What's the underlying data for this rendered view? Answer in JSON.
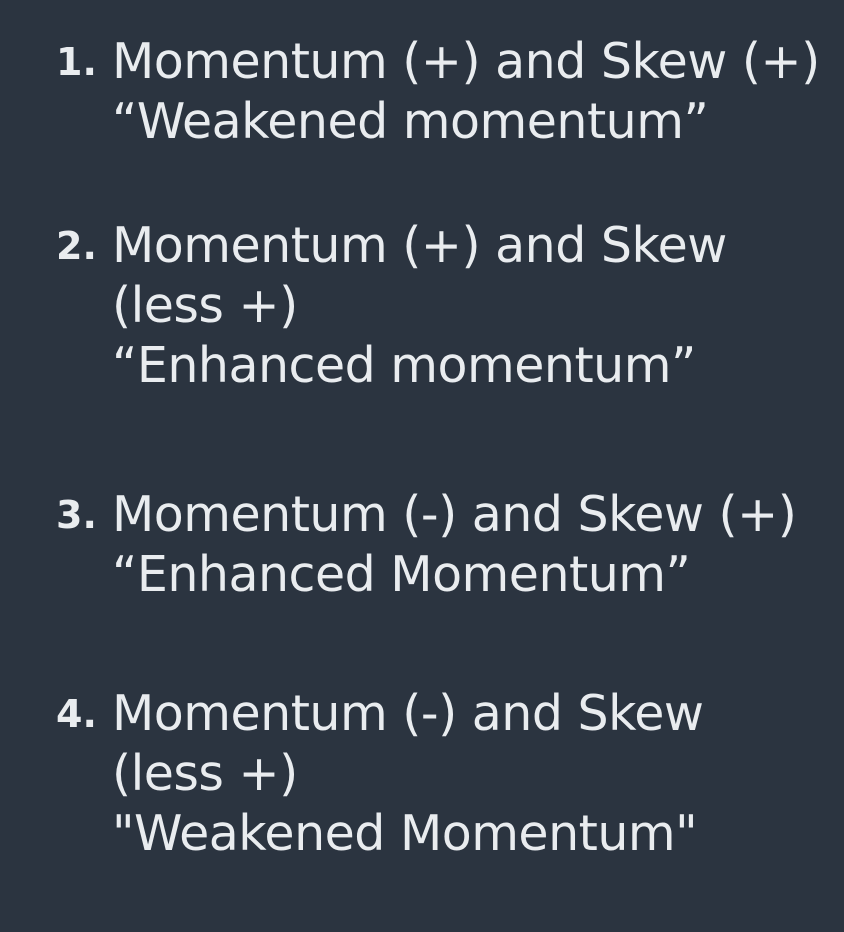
{
  "items": [
    {
      "number": "1.",
      "lines": [
        "Momentum (+) and Skew (+)",
        "“Weakened momentum”"
      ]
    },
    {
      "number": "2.",
      "lines": [
        "Momentum (+) and Skew",
        "(less +)",
        "“Enhanced momentum”"
      ]
    },
    {
      "number": "3.",
      "lines": [
        "Momentum (-) and Skew (+)",
        "“Enhanced Momentum”"
      ]
    },
    {
      "number": "4.",
      "lines": [
        "Momentum (-) and Skew",
        "(less +)",
        "\"Weakened Momentum\""
      ]
    }
  ]
}
